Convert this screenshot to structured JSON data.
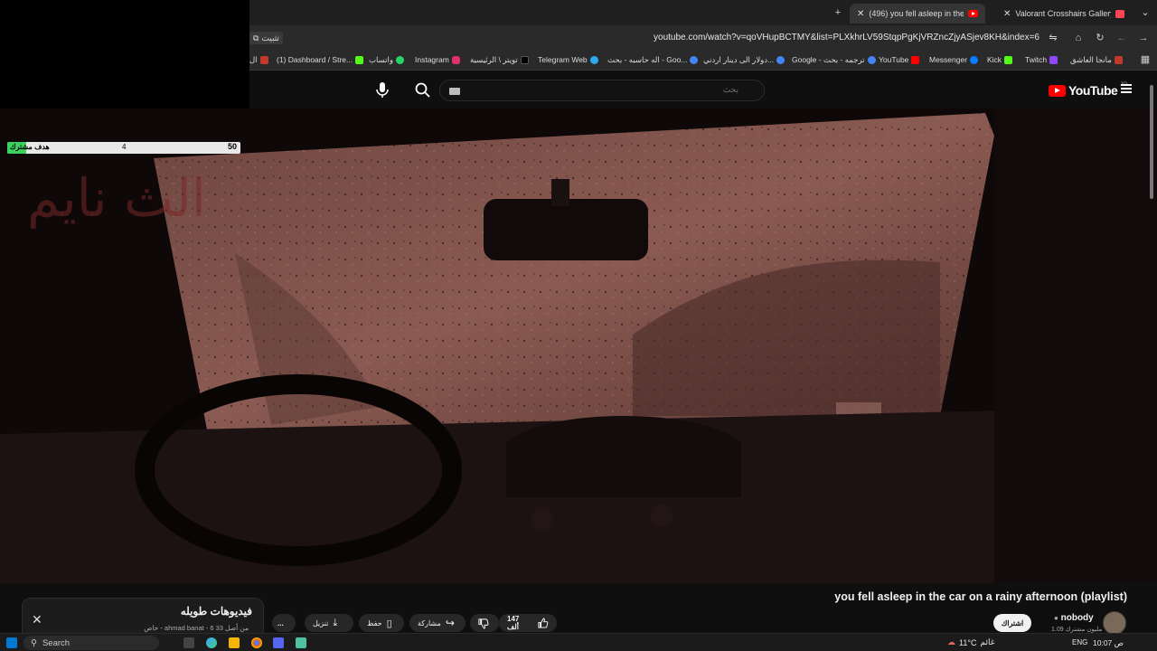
{
  "browser": {
    "tabs": [
      {
        "label": "(496) you fell asleep in the"
      },
      {
        "label": "Valorant Crosshairs Gallery - Va"
      }
    ],
    "url": "youtube.com/watch?v=qoVHupBCTMY&list=PLXkhrLV59StqpPgKjVRZncZjyASjev8KH&index=6",
    "notify_chip": "تثبيت",
    "new_tab": "+",
    "bookmarks": [
      {
        "label": "مانجا العاشق",
        "color": "#c0392b"
      },
      {
        "label": "Twitch",
        "color": "#9146ff"
      },
      {
        "label": "Kick",
        "color": "#53fc18"
      },
      {
        "label": "Messenger",
        "color": "#0a7cff"
      },
      {
        "label": "YouTube",
        "color": "#ff0000"
      },
      {
        "label": "Google - ترجمه - بحث",
        "color": "#4285f4"
      },
      {
        "label": "دولار الى دينار اردني...",
        "color": "#4285f4"
      },
      {
        "label": "اله حاسبه - بحث - Goo...",
        "color": "#4285f4"
      },
      {
        "label": "Telegram Web",
        "color": "#2aabee"
      },
      {
        "label": "تويتر \\ الرئيسية",
        "color": "#000000"
      },
      {
        "label": "Instagram",
        "color": "#e1306c"
      },
      {
        "label": "واتساب",
        "color": "#25d366"
      },
      {
        "label": "(1) Dashboard / Stre...",
        "color": "#53fc18"
      },
      {
        "label": "ال",
        "color": "#c0392b"
      }
    ]
  },
  "youtube": {
    "search_placeholder": "بحث",
    "logo_text": "YouTube",
    "logo_sup": "JO"
  },
  "stream_overlay": {
    "goal_label": "هدف مشترك",
    "goal_current": "4",
    "goal_target": "50",
    "goal_progress_fraction": 0.08,
    "big_text": "الث نايم"
  },
  "video": {
    "title": "you fell asleep in the car on a rainy afternoon (playlist)",
    "channel_name": "nobody",
    "subscribers": "1.09 مليون مشترك",
    "subscribe_label": "اشتراك",
    "likes": "147 ألف",
    "share_label": "مشاركة",
    "save_label": "حفظ",
    "download_label": "تنزيل",
    "more_label": "..."
  },
  "playlist": {
    "title": "فيديوهات طويله",
    "meta": "خاص - ahmad banat - 6 من أصل 33"
  },
  "taskbar": {
    "search_label": "Search",
    "weather": "11°C",
    "weather_text": "غائم",
    "lang": "ENG",
    "time": "10:07 ص"
  }
}
